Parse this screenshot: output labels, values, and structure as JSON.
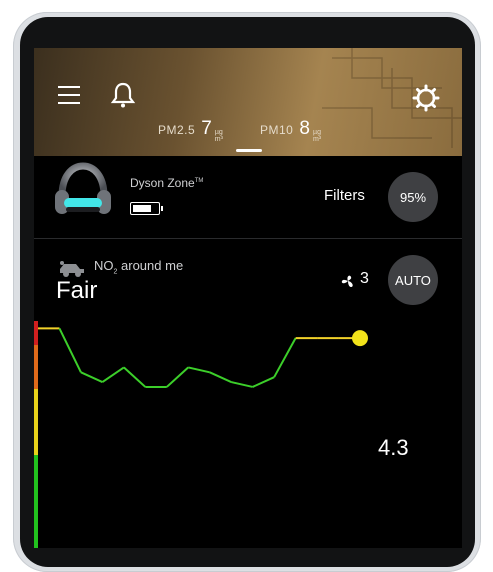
{
  "header": {
    "pm25": {
      "label": "PM2.5",
      "value": "7",
      "unit_top": "µg",
      "unit_bottom": "m³"
    },
    "pm10": {
      "label": "PM10",
      "value": "8",
      "unit_top": "µg",
      "unit_bottom": "m³"
    }
  },
  "device": {
    "name": "Dyson Zone",
    "trademark": "TM",
    "filters_label": "Filters",
    "filters_value": "95%",
    "battery_level": 0.8
  },
  "air": {
    "pollutant_prefix": "NO",
    "pollutant_sub": "2",
    "pollutant_suffix": " around me",
    "quality": "Fair",
    "fan_speed": "3",
    "mode_button": "AUTO",
    "current_reading": "4.3"
  },
  "chart_data": {
    "type": "line",
    "title": "",
    "xlabel": "",
    "ylabel": "",
    "x": [
      0,
      1,
      2,
      3,
      4,
      5,
      6,
      7,
      8,
      9,
      10,
      11,
      12,
      13,
      14,
      15
    ],
    "series": [
      {
        "values": [
          4.5,
          4.5,
          3.6,
          3.4,
          3.7,
          3.3,
          3.3,
          3.7,
          3.6,
          3.4,
          3.3,
          3.5,
          4.3,
          4.3,
          4.3,
          4.3
        ]
      }
    ],
    "colors": {
      "line_high": "#f2d22a",
      "line_low": "#3ccf2a",
      "marker": "#f2e21a"
    },
    "scale_bands": [
      "#d11f1f",
      "#e06a1a",
      "#e8d21a",
      "#22c21e"
    ]
  }
}
